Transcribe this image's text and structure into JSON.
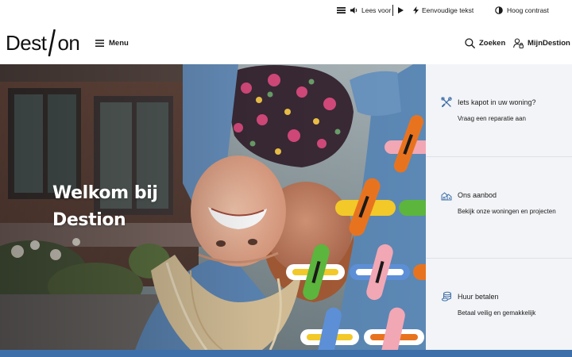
{
  "topbar": {
    "read_aloud": "Lees voor",
    "simple_text": "Eenvoudige tekst",
    "high_contrast": "Hoog contrast"
  },
  "header": {
    "logo_start": "Dest",
    "logo_end": "on",
    "menu_label": "Menu",
    "search_label": "Zoeken",
    "account_label": "MijnDestion"
  },
  "hero": {
    "title_line1": "Welkom bij",
    "title_line2": "Destion"
  },
  "cards": [
    {
      "icon": "tools-icon",
      "title": "Iets kapot in uw woning?",
      "desc": "Vraag een reparatie aan"
    },
    {
      "icon": "houses-icon",
      "title": "Ons aanbod",
      "desc": "Bekijk onze woningen en projecten"
    },
    {
      "icon": "coins-icon",
      "title": "Huur betalen",
      "desc": "Betaal veilig en gemakkelijk"
    }
  ],
  "colors": {
    "brand_blue": "#3f6fa8",
    "card_bg": "#f2f4f7",
    "plus_orange": "#e8731f",
    "plus_pink": "#f2a7b4",
    "plus_yellow": "#f2c928",
    "plus_green": "#5cb53d",
    "plus_blue": "#5d8fd6"
  }
}
